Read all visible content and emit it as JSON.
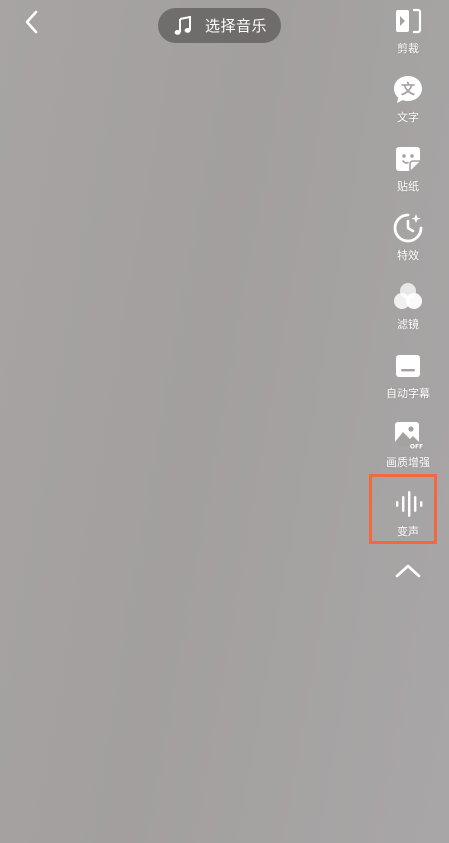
{
  "top_bar": {
    "music_label": "选择音乐"
  },
  "toolbar": {
    "items": [
      {
        "id": "cut",
        "label": "剪裁",
        "icon": "cut-icon"
      },
      {
        "id": "text",
        "label": "文字",
        "icon": "text-icon",
        "glyph": "文"
      },
      {
        "id": "sticker",
        "label": "贴纸",
        "icon": "sticker-icon"
      },
      {
        "id": "effects",
        "label": "特效",
        "icon": "effects-icon"
      },
      {
        "id": "filter",
        "label": "滤镜",
        "icon": "filter-icon"
      },
      {
        "id": "subtitles",
        "label": "自动字幕",
        "icon": "subtitles-icon"
      },
      {
        "id": "enhance",
        "label": "画质增强",
        "icon": "enhance-icon",
        "badge": "OFF"
      },
      {
        "id": "voice",
        "label": "变声",
        "icon": "voice-change-icon"
      }
    ]
  },
  "colors": {
    "highlight": "#f26a3b",
    "icon": "#ffffff"
  }
}
